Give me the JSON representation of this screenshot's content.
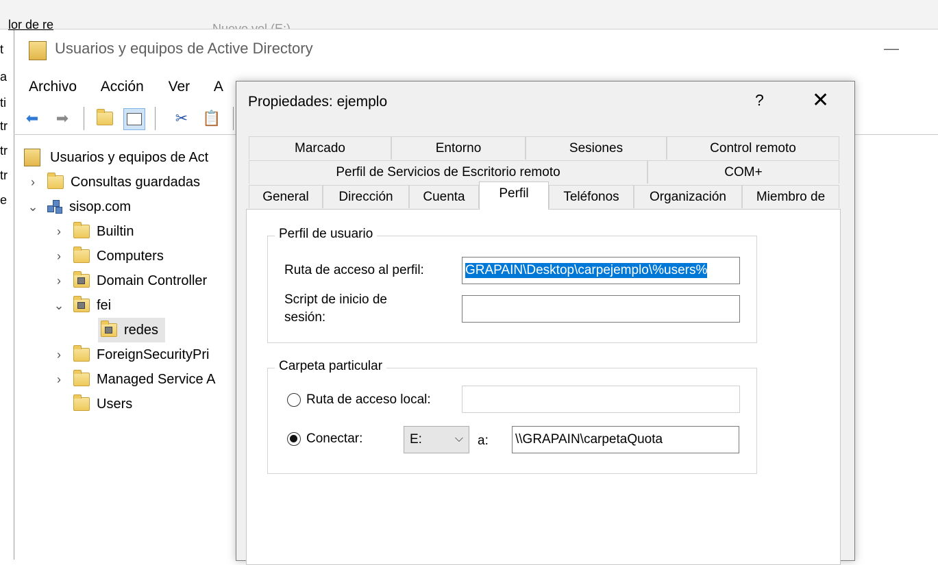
{
  "background": {
    "fragment_text": "lor de re",
    "fragment_text2": "Nuevo vol (E:)",
    "edge_chars": [
      "t",
      "a",
      "ti",
      "tr",
      "tr",
      "tr",
      "e"
    ]
  },
  "main_window": {
    "title": "Usuarios y equipos de Active Directory",
    "minimize": "—",
    "menu": [
      "Archivo",
      "Acción",
      "Ver",
      "A"
    ]
  },
  "tree": {
    "root": "Usuarios y equipos de Act",
    "items": [
      {
        "label": "Consultas guardadas"
      },
      {
        "label": "sisop.com"
      },
      {
        "label": "Builtin"
      },
      {
        "label": "Computers"
      },
      {
        "label": "Domain Controller"
      },
      {
        "label": "fei"
      },
      {
        "label": "redes"
      },
      {
        "label": "ForeignSecurityPri"
      },
      {
        "label": "Managed Service A"
      },
      {
        "label": "Users"
      }
    ]
  },
  "dialog": {
    "title": "Propiedades: ejemplo",
    "help": "?",
    "close": "✕",
    "tabs_row1": [
      "Marcado",
      "Entorno",
      "Sesiones",
      "Control remoto"
    ],
    "tabs_row2": [
      "Perfil de Servicios de Escritorio remoto",
      "COM+"
    ],
    "tabs_row3": [
      "General",
      "Dirección",
      "Cuenta",
      "Perfil",
      "Teléfonos",
      "Organización",
      "Miembro de"
    ],
    "active_tab": "Perfil",
    "user_profile": {
      "legend": "Perfil de usuario",
      "profile_path_label": "Ruta de acceso al perfil:",
      "profile_path_value": "GRAPAIN\\Desktop\\carpejemplo\\%users%",
      "logon_script_label_1": "Script de inicio de",
      "logon_script_label_2": "sesión:",
      "logon_script_value": ""
    },
    "home_folder": {
      "legend": "Carpeta particular",
      "local_path_label": "Ruta de acceso local:",
      "local_path_value": "",
      "connect_label": "Conectar:",
      "drive": "E:",
      "to_label": "a:",
      "connect_path": "\\\\GRAPAIN\\carpetaQuota"
    }
  }
}
